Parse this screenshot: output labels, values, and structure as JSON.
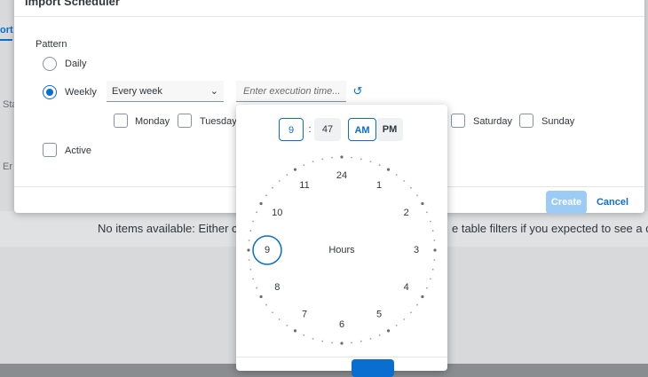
{
  "dialog": {
    "title": "Import Scheduler",
    "pattern_label": "Pattern",
    "daily_label": "Daily",
    "weekly_label": "Weekly",
    "frequency_value": "Every week",
    "time_placeholder": "Enter execution time...",
    "days": [
      "Monday",
      "Tuesday",
      "Saturday",
      "Sunday"
    ],
    "active_label": "Active",
    "create_label": "Create",
    "cancel_label": "Cancel"
  },
  "background": {
    "tab_fragment": "ort",
    "label_sta": "Sta",
    "label_e": "Er",
    "message_left": "No items available: Either crea",
    "message_right": "e table filters if you expected to see a queu"
  },
  "time_picker": {
    "hour": "9",
    "separator": ":",
    "minute": "47",
    "am_label": "AM",
    "pm_label": "PM",
    "selected_period": "AM",
    "center_label": "Hours",
    "dial_numbers": [
      "24",
      "1",
      "2",
      "3",
      "4",
      "5",
      "6",
      "7",
      "8",
      "9",
      "10",
      "11"
    ],
    "selected_hour": "9"
  },
  "colors": {
    "accent": "#0a6ed1",
    "create_disabled": "#9ccbf5"
  }
}
